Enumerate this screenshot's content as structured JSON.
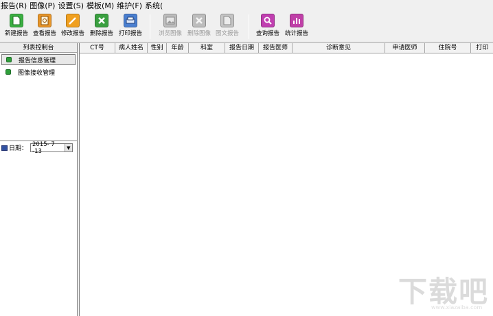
{
  "menu": [
    {
      "label": "报告(R)"
    },
    {
      "label": "图像(P)"
    },
    {
      "label": "设置(S)"
    },
    {
      "label": "模板(M)"
    },
    {
      "label": "维护(F)"
    },
    {
      "label": "系统("
    }
  ],
  "toolbar": {
    "new_report": "新建报告",
    "view_report": "查看报告",
    "edit_report": "修改报告",
    "delete_report": "删除报告",
    "print_report": "打印报告",
    "browse_image": "浏览图像",
    "delete_image": "删除图像",
    "image_text_report": "图文报告",
    "query_report": "查询报告",
    "stats_report": "统计报告"
  },
  "left_panel": {
    "title": "列表控制台",
    "items": [
      {
        "label": "报告信息管理"
      },
      {
        "label": "图像接收管理"
      }
    ],
    "date_label": "日期：",
    "date_value": "2015- 7 -13"
  },
  "grid": {
    "columns": [
      {
        "label": "CT号"
      },
      {
        "label": "病人姓名"
      },
      {
        "label": "性别"
      },
      {
        "label": "年龄"
      },
      {
        "label": "科室"
      },
      {
        "label": "报告日期"
      },
      {
        "label": "报告医师"
      },
      {
        "label": "诊断意见"
      },
      {
        "label": "申请医师"
      },
      {
        "label": "住院号"
      },
      {
        "label": "打印"
      }
    ]
  },
  "watermark": {
    "main": "下载吧",
    "sub": "www.xiazaiba.com"
  },
  "colors": {
    "new": "#3cb043",
    "view": "#e8962a",
    "edit": "#f0a020",
    "delete": "#3aa040",
    "print": "#4a7fd0",
    "query": "#c03fb0",
    "stats": "#c040a8",
    "disabled": "#bdbdbd"
  }
}
